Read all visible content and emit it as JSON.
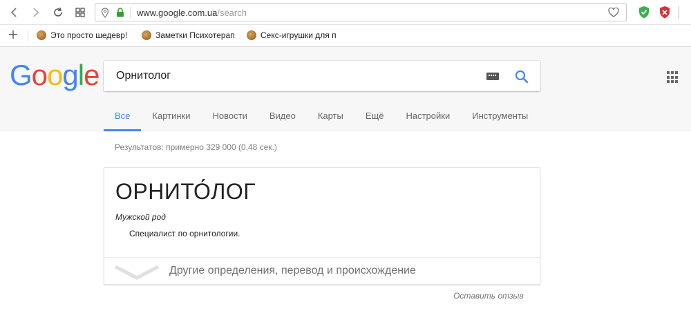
{
  "browser": {
    "url_host": "www.google.com.ua",
    "url_path": "/search"
  },
  "bookmarks": [
    {
      "label": "Это просто шедевр!"
    },
    {
      "label": "Заметки Психотерап"
    },
    {
      "label": "Секс-игрушки для п"
    }
  ],
  "google": {
    "logo_letters": [
      {
        "ch": "G",
        "color": "#4285F4"
      },
      {
        "ch": "o",
        "color": "#EA4335"
      },
      {
        "ch": "o",
        "color": "#FBBC05"
      },
      {
        "ch": "g",
        "color": "#4285F4"
      },
      {
        "ch": "l",
        "color": "#34A853"
      },
      {
        "ch": "e",
        "color": "#EA4335"
      }
    ],
    "query": "Орнитолог",
    "tabs": [
      {
        "label": "Все",
        "active": true
      },
      {
        "label": "Картинки"
      },
      {
        "label": "Новости"
      },
      {
        "label": "Видео"
      },
      {
        "label": "Карты"
      },
      {
        "label": "Ещё"
      },
      {
        "label": "Настройки"
      },
      {
        "label": "Инструменты"
      }
    ],
    "result_stats": "Результатов: примерно 329 000 (0,48 сек.)"
  },
  "dictionary": {
    "word": "ОРНИТО́ЛОГ",
    "part_of_speech": "Мужской род",
    "definition": "Специалист по орнитологии.",
    "more_link": "Другие определения, перевод и происхождение"
  },
  "feedback_link": "Оставить отзыв",
  "colors": {
    "accent": "#4285F4",
    "secure_lock": "#2fa12f",
    "ext_shield_green": "#3cb04a",
    "ext_shield_red": "#d9303e"
  }
}
